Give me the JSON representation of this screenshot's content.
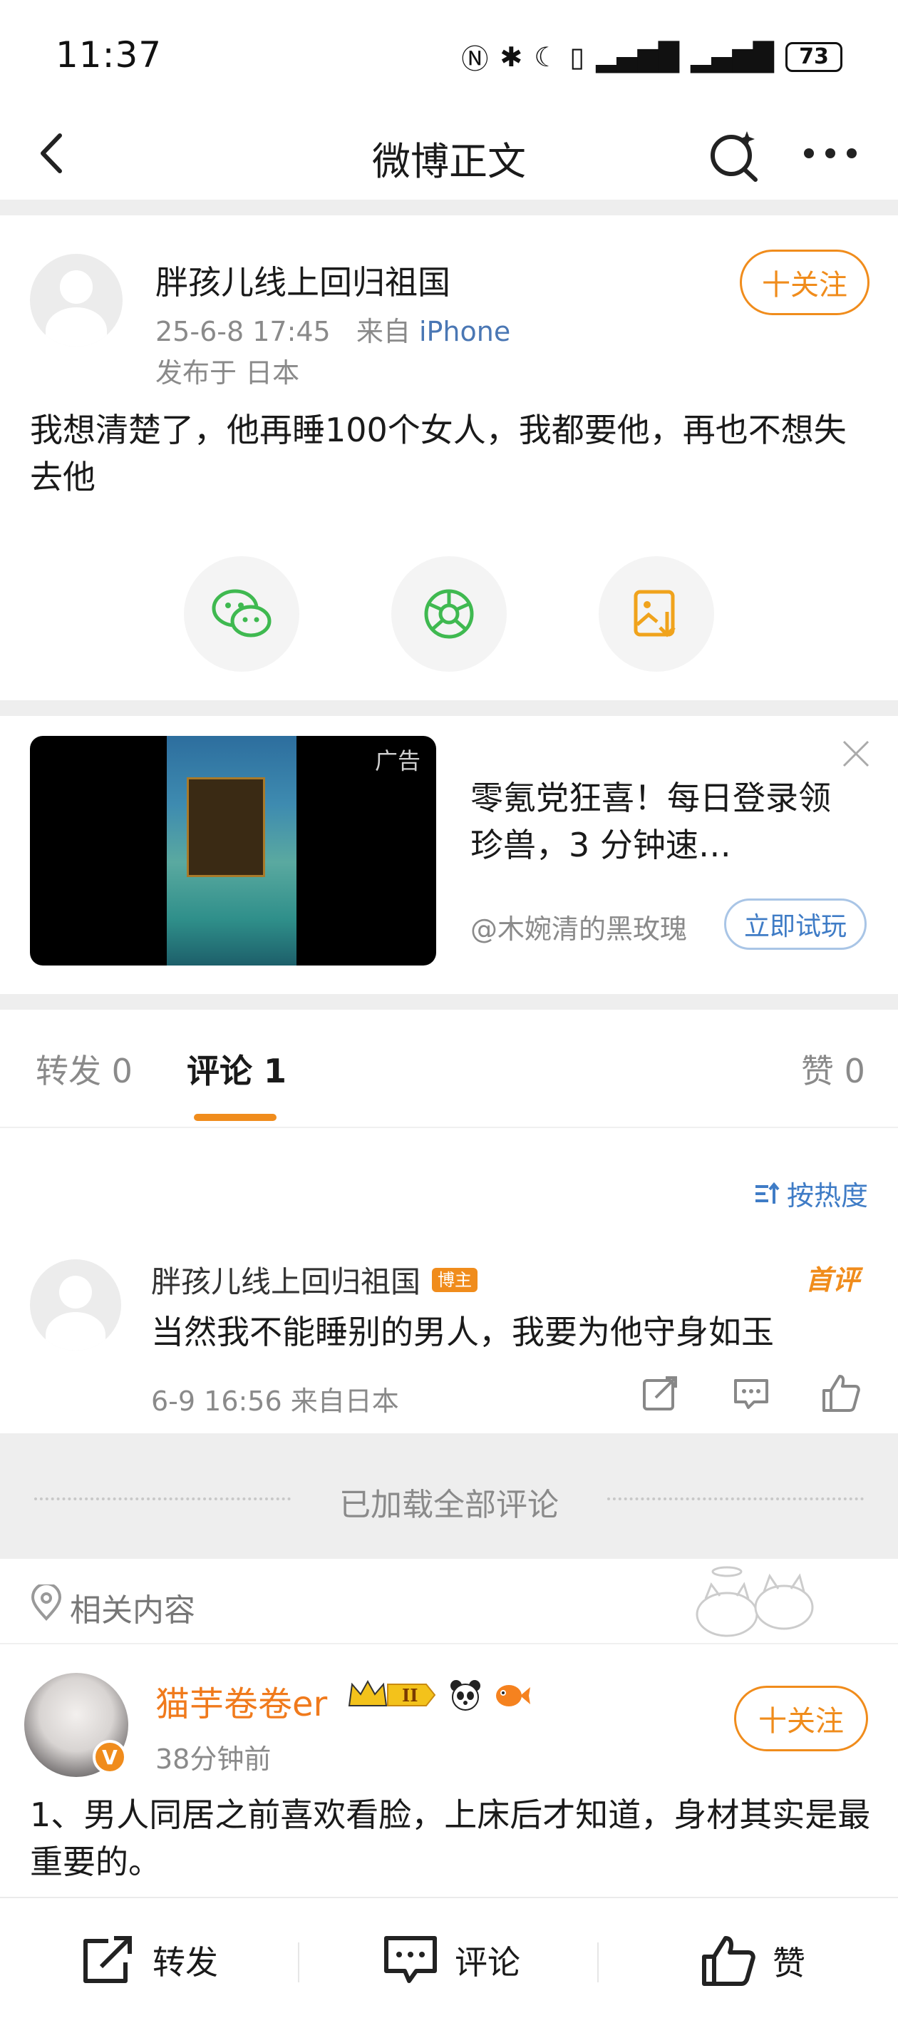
{
  "status": {
    "time": "11:37",
    "battery": "73"
  },
  "nav": {
    "title": "微博正文"
  },
  "post": {
    "author": "胖孩儿线上回归祖国",
    "time": "25-6-8 17:45",
    "source_prefix": "来自",
    "source": "iPhone",
    "location": "发布于 日本",
    "follow_label": "十关注",
    "text": "我想清楚了，他再睡100个女人，我都要他，再也不想失去他"
  },
  "ad": {
    "tag": "广告",
    "title": "零氪党狂喜！每日登录领珍兽，3 分钟速…",
    "source": "@木婉清的黑玫瑰",
    "cta": "立即试玩"
  },
  "tabs": [
    {
      "label": "转发 0"
    },
    {
      "label": "评论 1"
    },
    {
      "label": "赞 0"
    }
  ],
  "sort_label": "按热度",
  "comment": {
    "author": "胖孩儿线上回归祖国",
    "author_tag": "博主",
    "first_tag": "首评",
    "text": "当然我不能睡别的男人，我要为他守身如玉",
    "meta": "6-9 16:56  来自日本"
  },
  "loaded_label": "已加载全部评论",
  "related": {
    "label": "相关内容",
    "post": {
      "author": "猫芋卷卷er",
      "time": "38分钟前",
      "follow_label": "十关注",
      "text": "1、男人同居之前喜欢看脸，上床后才知道，身材其实是最重要的。"
    }
  },
  "bottom": {
    "repost": "转发",
    "comment": "评论",
    "like": "赞"
  },
  "colors": {
    "accent": "#f08c1c",
    "link": "#3f7cc6"
  }
}
